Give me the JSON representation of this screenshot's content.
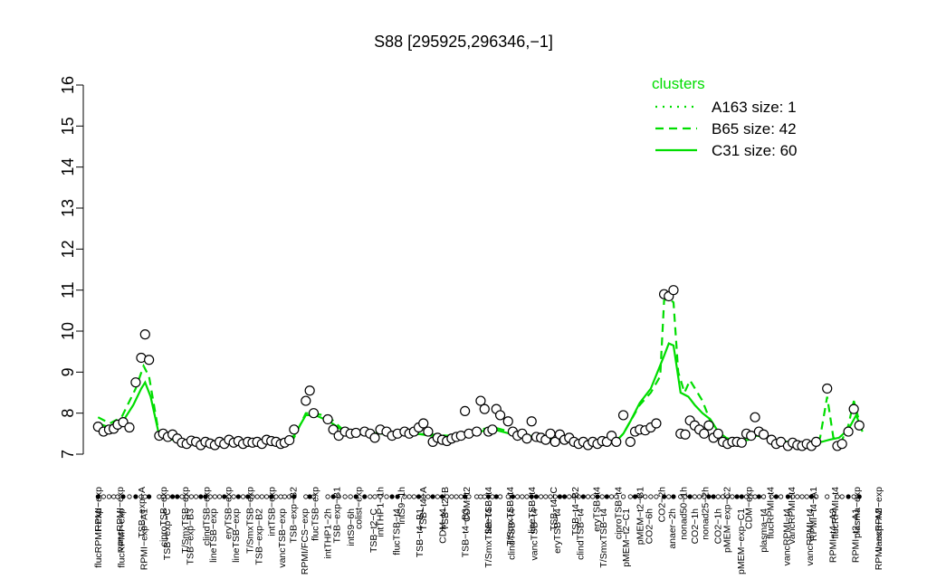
{
  "chart_data": {
    "type": "line",
    "title": "S88 [295925,296346,−1]",
    "xlabel": "",
    "ylabel": "",
    "ylim": [
      7,
      16
    ],
    "yticks": [
      7,
      8,
      9,
      10,
      11,
      12,
      13,
      14,
      15,
      16
    ],
    "grid": false,
    "legend": {
      "title": "clusters",
      "placement": "top-right",
      "entries": [
        {
          "label": "A163 size: 1",
          "style": "dotted"
        },
        {
          "label": "B65 size: 42",
          "style": "dashed"
        },
        {
          "label": "C31 size: 60",
          "style": "solid"
        }
      ]
    },
    "series_color": "#00dd00",
    "xlim": [
      0,
      100
    ],
    "upper_tick_labels": [
      "RPMI−exp",
      "vancRPMI−exp",
      "TSB−exp−A",
      "ciproTSB−exp",
      "T/SmxTSB−exp",
      "clindTSB−exp",
      "eryTSB−exp",
      "T/SmxTSB−exp",
      "intTSB−exp",
      "TSB−exp−B2",
      "flucTSB−exp",
      "TSB−exp−B1",
      "colist−exp",
      "intTHP1−1h",
      "intS9−1h",
      "TSB−t4−A",
      "TSB−t2−B",
      "CDM−t2",
      "lineTSB−t4",
      "T/SmxTSB−t4",
      "lineTSB−t4",
      "TSB−t4−C",
      "TSB−t4−B2",
      "eryTSB−t4",
      "ciproTSB−t4",
      "pMEM−t2−B1",
      "CO2−2h",
      "nonad50−1h",
      "nonad25−2h",
      "pMEM−exp−C2",
      "CDM−exp",
      "flucRPMI−t4",
      "vancRPMI−t4",
      "RPMI−t4−A1",
      "flucRPMI−t4",
      "plasma−exp",
      "vancRPMI−exp"
    ],
    "lower_tick_labels": [
      "flucRPMI−exp",
      "flucRPMI−exp",
      "RPMI−exp−A1",
      "TSB−exp−C",
      "TSB−exp−B3",
      "lineTSB−exp",
      "lineTSB−exp",
      "TSB−exp−B2",
      "vancTSB−exp",
      "RPMI/FCS−exp",
      "intTHP1−2h",
      "intS9−6h",
      "TSB−t2−C",
      "flucTSB−t4",
      "TSB−t4−B1",
      "CDM−t4",
      "TSB−t4−B3",
      "T/SmxTSB−t4",
      "clindTSB−t4",
      "vancTSB−t4",
      "eryTSB−t4",
      "clindTSB−t4",
      "T/SmxTSB−t4",
      "pMEM−t2−C1",
      "CO2−6h",
      "anaer−2h",
      "CO2−1h",
      "CO2−1h",
      "pMEM−exp−C1",
      "plasma−t4",
      "vancRPMI−t4",
      "vancRPMI−t4",
      "RPMI−t4−A2",
      "RPMI−t2−A1",
      "RPMI−exp−A2"
    ],
    "points": [
      {
        "x": 0.5,
        "y": 7.67
      },
      {
        "x": 1.2,
        "y": 7.55
      },
      {
        "x": 1.9,
        "y": 7.6
      },
      {
        "x": 2.5,
        "y": 7.62
      },
      {
        "x": 3.0,
        "y": 7.72
      },
      {
        "x": 3.7,
        "y": 7.78
      },
      {
        "x": 4.5,
        "y": 7.65
      },
      {
        "x": 5.3,
        "y": 8.75
      },
      {
        "x": 6.0,
        "y": 9.35
      },
      {
        "x": 6.5,
        "y": 9.92
      },
      {
        "x": 7.0,
        "y": 9.3
      },
      {
        "x": 8.3,
        "y": 7.45
      },
      {
        "x": 8.8,
        "y": 7.5
      },
      {
        "x": 9.4,
        "y": 7.42
      },
      {
        "x": 10.0,
        "y": 7.48
      },
      {
        "x": 10.6,
        "y": 7.38
      },
      {
        "x": 11.2,
        "y": 7.28
      },
      {
        "x": 11.8,
        "y": 7.25
      },
      {
        "x": 12.4,
        "y": 7.33
      },
      {
        "x": 13.0,
        "y": 7.3
      },
      {
        "x": 13.6,
        "y": 7.22
      },
      {
        "x": 14.2,
        "y": 7.3
      },
      {
        "x": 14.8,
        "y": 7.26
      },
      {
        "x": 15.4,
        "y": 7.22
      },
      {
        "x": 16.0,
        "y": 7.3
      },
      {
        "x": 16.6,
        "y": 7.25
      },
      {
        "x": 17.2,
        "y": 7.35
      },
      {
        "x": 17.8,
        "y": 7.28
      },
      {
        "x": 18.4,
        "y": 7.32
      },
      {
        "x": 19.0,
        "y": 7.25
      },
      {
        "x": 19.6,
        "y": 7.3
      },
      {
        "x": 20.2,
        "y": 7.28
      },
      {
        "x": 20.8,
        "y": 7.3
      },
      {
        "x": 21.4,
        "y": 7.25
      },
      {
        "x": 22.0,
        "y": 7.35
      },
      {
        "x": 22.6,
        "y": 7.32
      },
      {
        "x": 23.2,
        "y": 7.3
      },
      {
        "x": 23.8,
        "y": 7.25
      },
      {
        "x": 24.3,
        "y": 7.28
      },
      {
        "x": 24.9,
        "y": 7.34
      },
      {
        "x": 25.5,
        "y": 7.6
      },
      {
        "x": 27.0,
        "y": 8.3
      },
      {
        "x": 27.5,
        "y": 8.55
      },
      {
        "x": 28.0,
        "y": 8.0
      },
      {
        "x": 29.8,
        "y": 7.85
      },
      {
        "x": 30.5,
        "y": 7.6
      },
      {
        "x": 31.2,
        "y": 7.45
      },
      {
        "x": 32.0,
        "y": 7.55
      },
      {
        "x": 32.7,
        "y": 7.5
      },
      {
        "x": 33.4,
        "y": 7.52
      },
      {
        "x": 34.5,
        "y": 7.55
      },
      {
        "x": 35.2,
        "y": 7.5
      },
      {
        "x": 35.8,
        "y": 7.4
      },
      {
        "x": 36.5,
        "y": 7.6
      },
      {
        "x": 37.3,
        "y": 7.55
      },
      {
        "x": 38.0,
        "y": 7.45
      },
      {
        "x": 38.7,
        "y": 7.5
      },
      {
        "x": 39.6,
        "y": 7.55
      },
      {
        "x": 40.2,
        "y": 7.5
      },
      {
        "x": 40.8,
        "y": 7.55
      },
      {
        "x": 41.4,
        "y": 7.65
      },
      {
        "x": 42.0,
        "y": 7.75
      },
      {
        "x": 42.6,
        "y": 7.55
      },
      {
        "x": 43.2,
        "y": 7.3
      },
      {
        "x": 43.8,
        "y": 7.4
      },
      {
        "x": 44.4,
        "y": 7.35
      },
      {
        "x": 45.0,
        "y": 7.32
      },
      {
        "x": 45.6,
        "y": 7.38
      },
      {
        "x": 46.2,
        "y": 7.42
      },
      {
        "x": 46.8,
        "y": 7.45
      },
      {
        "x": 47.3,
        "y": 8.05
      },
      {
        "x": 47.8,
        "y": 7.5
      },
      {
        "x": 48.8,
        "y": 7.55
      },
      {
        "x": 49.3,
        "y": 8.3
      },
      {
        "x": 49.8,
        "y": 8.1
      },
      {
        "x": 50.3,
        "y": 7.55
      },
      {
        "x": 50.8,
        "y": 7.6
      },
      {
        "x": 51.3,
        "y": 8.1
      },
      {
        "x": 51.8,
        "y": 7.95
      },
      {
        "x": 52.8,
        "y": 7.8
      },
      {
        "x": 53.4,
        "y": 7.55
      },
      {
        "x": 54.0,
        "y": 7.45
      },
      {
        "x": 54.6,
        "y": 7.5
      },
      {
        "x": 55.2,
        "y": 7.38
      },
      {
        "x": 55.8,
        "y": 7.8
      },
      {
        "x": 56.4,
        "y": 7.42
      },
      {
        "x": 57.0,
        "y": 7.4
      },
      {
        "x": 57.6,
        "y": 7.35
      },
      {
        "x": 58.2,
        "y": 7.5
      },
      {
        "x": 58.8,
        "y": 7.3
      },
      {
        "x": 59.4,
        "y": 7.48
      },
      {
        "x": 60.0,
        "y": 7.35
      },
      {
        "x": 60.6,
        "y": 7.4
      },
      {
        "x": 61.2,
        "y": 7.3
      },
      {
        "x": 61.8,
        "y": 7.25
      },
      {
        "x": 62.4,
        "y": 7.3
      },
      {
        "x": 63.0,
        "y": 7.22
      },
      {
        "x": 63.6,
        "y": 7.3
      },
      {
        "x": 64.2,
        "y": 7.25
      },
      {
        "x": 64.8,
        "y": 7.32
      },
      {
        "x": 65.4,
        "y": 7.3
      },
      {
        "x": 66.0,
        "y": 7.45
      },
      {
        "x": 66.6,
        "y": 7.3
      },
      {
        "x": 67.5,
        "y": 7.95
      },
      {
        "x": 68.4,
        "y": 7.3
      },
      {
        "x": 69.0,
        "y": 7.55
      },
      {
        "x": 69.6,
        "y": 7.6
      },
      {
        "x": 70.3,
        "y": 7.58
      },
      {
        "x": 71.0,
        "y": 7.65
      },
      {
        "x": 71.7,
        "y": 7.75
      },
      {
        "x": 72.7,
        "y": 10.9
      },
      {
        "x": 73.3,
        "y": 10.85
      },
      {
        "x": 73.9,
        "y": 11.0
      },
      {
        "x": 74.8,
        "y": 7.5
      },
      {
        "x": 75.4,
        "y": 7.48
      },
      {
        "x": 76.0,
        "y": 7.82
      },
      {
        "x": 76.6,
        "y": 7.7
      },
      {
        "x": 77.2,
        "y": 7.6
      },
      {
        "x": 77.8,
        "y": 7.5
      },
      {
        "x": 78.4,
        "y": 7.7
      },
      {
        "x": 79.0,
        "y": 7.4
      },
      {
        "x": 79.6,
        "y": 7.5
      },
      {
        "x": 80.2,
        "y": 7.3
      },
      {
        "x": 80.8,
        "y": 7.25
      },
      {
        "x": 81.4,
        "y": 7.3
      },
      {
        "x": 82.0,
        "y": 7.3
      },
      {
        "x": 82.6,
        "y": 7.28
      },
      {
        "x": 83.2,
        "y": 7.5
      },
      {
        "x": 83.8,
        "y": 7.45
      },
      {
        "x": 84.3,
        "y": 7.9
      },
      {
        "x": 84.8,
        "y": 7.55
      },
      {
        "x": 85.4,
        "y": 7.48
      },
      {
        "x": 86.4,
        "y": 7.35
      },
      {
        "x": 87.0,
        "y": 7.25
      },
      {
        "x": 87.6,
        "y": 7.3
      },
      {
        "x": 88.5,
        "y": 7.2
      },
      {
        "x": 89.1,
        "y": 7.28
      },
      {
        "x": 89.7,
        "y": 7.22
      },
      {
        "x": 90.3,
        "y": 7.2
      },
      {
        "x": 90.9,
        "y": 7.25
      },
      {
        "x": 91.5,
        "y": 7.2
      },
      {
        "x": 92.1,
        "y": 7.3
      },
      {
        "x": 93.5,
        "y": 8.6
      },
      {
        "x": 94.8,
        "y": 7.2
      },
      {
        "x": 95.4,
        "y": 7.25
      },
      {
        "x": 96.2,
        "y": 7.55
      },
      {
        "x": 96.9,
        "y": 8.1
      },
      {
        "x": 97.6,
        "y": 7.7
      }
    ],
    "series": [
      {
        "name": "C31 size: 60",
        "style": "solid",
        "x": [
          0.5,
          2,
          3.5,
          5,
          6,
          6.5,
          7.2,
          8.3,
          10,
          12,
          14,
          16,
          18,
          20,
          22,
          24,
          25.5,
          27,
          28.2,
          30,
          31.5,
          33,
          35,
          37,
          39,
          41,
          43,
          45,
          47,
          49,
          51,
          53,
          55,
          57,
          59,
          61,
          63,
          65,
          66.6,
          67.5,
          68.4,
          69.6,
          71,
          72.7,
          73.3,
          73.9,
          74.8,
          75.8,
          76.6,
          77.6,
          78.6,
          79.6,
          80.6,
          82,
          83.5,
          84.5,
          85.8,
          87,
          88.5,
          90,
          91.5,
          92.8,
          93.8,
          95,
          96.2,
          97.2,
          98
        ],
        "y": [
          7.75,
          7.65,
          7.75,
          8.2,
          8.6,
          8.75,
          8.4,
          7.45,
          7.35,
          7.3,
          7.3,
          7.3,
          7.32,
          7.3,
          7.3,
          7.3,
          7.45,
          7.95,
          7.95,
          7.8,
          7.6,
          7.55,
          7.5,
          7.5,
          7.5,
          7.5,
          7.45,
          7.42,
          7.45,
          7.55,
          7.6,
          7.5,
          7.45,
          7.4,
          7.35,
          7.3,
          7.28,
          7.3,
          7.32,
          7.5,
          7.8,
          8.25,
          8.6,
          9.4,
          9.7,
          9.65,
          8.5,
          8.4,
          8.2,
          8.0,
          7.85,
          7.55,
          7.4,
          7.3,
          7.35,
          7.45,
          7.4,
          7.35,
          7.3,
          7.28,
          7.3,
          7.3,
          7.35,
          7.4,
          7.6,
          7.95,
          7.55
        ]
      },
      {
        "name": "B65 size: 42",
        "style": "dashed",
        "x": [
          0.5,
          2,
          3.5,
          5.3,
          6.3,
          7,
          8.3,
          10,
          12,
          14,
          16,
          18,
          20,
          22,
          24,
          25.5,
          27,
          28.2,
          30,
          32,
          34,
          37,
          40,
          43,
          45,
          47,
          49,
          51,
          53,
          55,
          57,
          59,
          61,
          63,
          65,
          66.6,
          67.5,
          68.4,
          69.6,
          71,
          72.2,
          72.7,
          73.3,
          73.9,
          74.5,
          75.3,
          76,
          76.8,
          77.6,
          78.6,
          79.6,
          80.6,
          82,
          83.8,
          84.6,
          85.8,
          87,
          88.5,
          90,
          91.5,
          92.6,
          93.5,
          94.3,
          95.3,
          96.2,
          96.9,
          97.8
        ],
        "y": [
          7.9,
          7.75,
          7.9,
          8.6,
          9.15,
          8.9,
          7.45,
          7.4,
          7.3,
          7.3,
          7.28,
          7.3,
          7.28,
          7.3,
          7.3,
          7.4,
          8.0,
          8.0,
          7.9,
          7.55,
          7.55,
          7.5,
          7.5,
          7.48,
          7.45,
          7.5,
          7.6,
          7.65,
          7.55,
          7.45,
          7.45,
          7.38,
          7.32,
          7.3,
          7.3,
          7.32,
          7.5,
          7.8,
          8.2,
          8.5,
          8.9,
          10.75,
          10.8,
          10.7,
          9.0,
          8.5,
          8.8,
          8.55,
          8.3,
          7.8,
          7.5,
          7.38,
          7.3,
          7.4,
          7.5,
          7.42,
          7.35,
          7.3,
          7.25,
          7.25,
          7.4,
          8.4,
          7.4,
          7.3,
          7.7,
          8.3,
          7.65
        ]
      },
      {
        "name": "A163 size: 1",
        "style": "dotted",
        "x": [],
        "y": []
      }
    ]
  }
}
